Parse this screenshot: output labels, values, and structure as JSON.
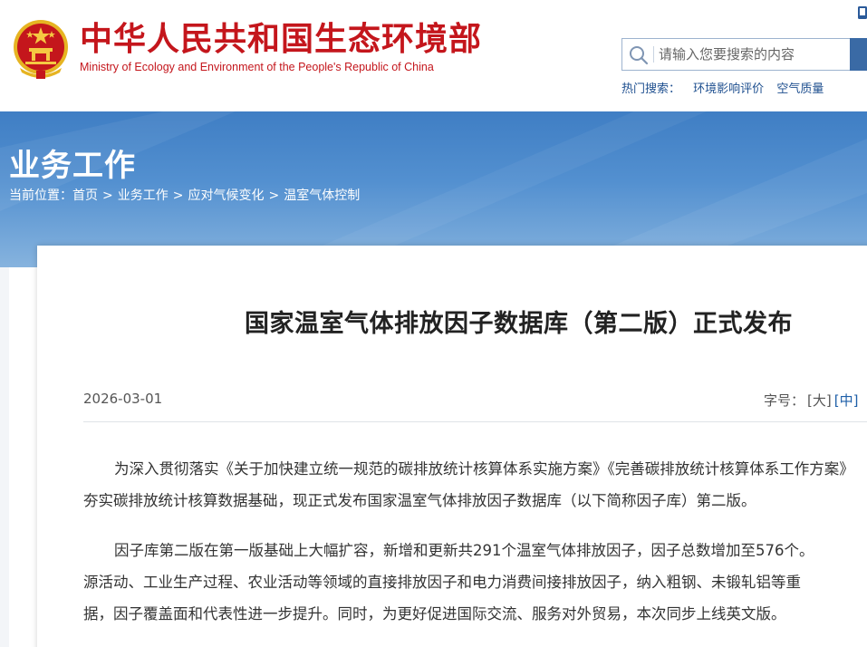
{
  "header": {
    "site_title": "中华人民共和国生态环境部",
    "site_subtitle": "Ministry of Ecology and Environment of the People's Republic of China",
    "search_placeholder": "请输入您要搜索的内容",
    "hot_search_label": "热门搜索：",
    "hot_search_items": [
      "环境影响评价",
      "空气质量"
    ],
    "brand_color": "#c4161c",
    "emblem_icon": "national-emblem-icon"
  },
  "banner": {
    "section_title": "业务工作",
    "breadcrumb_label": "当前位置：",
    "breadcrumb": [
      "首页",
      "业务工作",
      "应对气候变化",
      "温室气体控制"
    ],
    "separator": ">",
    "color": "#4a87c9"
  },
  "article": {
    "title": "国家温室气体排放因子数据库（第二版）正式发布",
    "date": "2026-03-01",
    "font_size_label": "字号：",
    "font_large": "[大]",
    "font_medium": "[中]",
    "paragraphs": [
      {
        "line1": "为深入贯彻落实《关于加快建立统一规范的碳排放统计核算体系实施方案》《完善碳排放统计核算体系工作方案》",
        "line2": "夯实碳排放统计核算数据基础，现正式发布国家温室气体排放因子数据库（以下简称因子库）第二版。"
      },
      {
        "line1": "因子库第二版在第一版基础上大幅扩容，新增和更新共291个温室气体排放因子，因子总数增加至576个。",
        "line2": "源活动、工业生产过程、农业活动等领域的直接排放因子和电力消费间接排放因子，纳入粗钢、未锻轧铝等重",
        "line3": "据，因子覆盖面和代表性进一步提升。同时，为更好促进国际交流、服务对外贸易，本次同步上线英文版。"
      }
    ]
  }
}
